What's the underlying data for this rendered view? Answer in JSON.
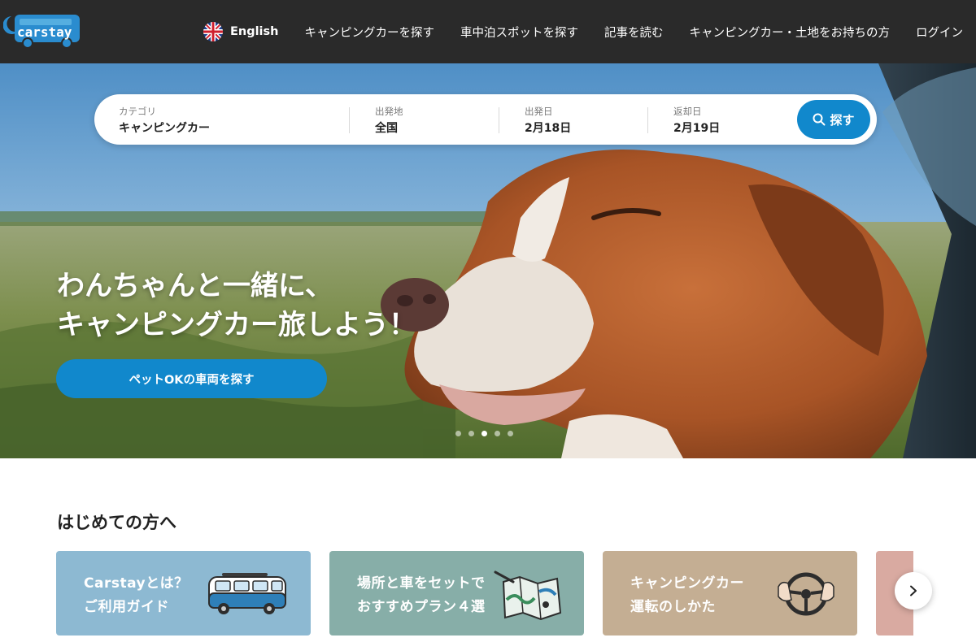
{
  "header": {
    "logo_text": "carstay",
    "language": "English",
    "nav": [
      "キャンピングカーを探す",
      "車中泊スポットを探す",
      "記事を読む",
      "キャンピングカー・土地をお持ちの方",
      "ログイン"
    ]
  },
  "search": {
    "category_label": "カテゴリ",
    "category_value": "キャンピングカー",
    "departure_label": "出発地",
    "departure_value": "全国",
    "start_label": "出発日",
    "start_value": "2月18日",
    "return_label": "返却日",
    "return_value": "2月19日",
    "button_label": "探す"
  },
  "hero": {
    "title_line1": "わんちゃんと一緒に、",
    "title_line2": "キャンピングカー旅しよう！",
    "cta_label": "ペットOKの車両を探す",
    "slide_count": 5,
    "active_slide": 3
  },
  "intro": {
    "section_title": "はじめての方へ",
    "cards": [
      {
        "line1": "Carstayとは？",
        "line2": "ご利用ガイド",
        "color": "#8db9d2",
        "icon": "van-icon"
      },
      {
        "line1": "場所と車をセットで",
        "line2": "おすすめプラン４選",
        "color": "#87aea8",
        "icon": "map-icon"
      },
      {
        "line1": "キャンピングカー",
        "line2": "運転のしかた",
        "color": "#c4ae93",
        "icon": "steering-wheel-icon"
      },
      {
        "line1": "",
        "line2": "",
        "color": "#d9aaa1",
        "icon": ""
      }
    ]
  },
  "colors": {
    "header_bg": "#2a2a2a",
    "accent": "#1188cc",
    "logo_blue": "#2a8ccf"
  }
}
